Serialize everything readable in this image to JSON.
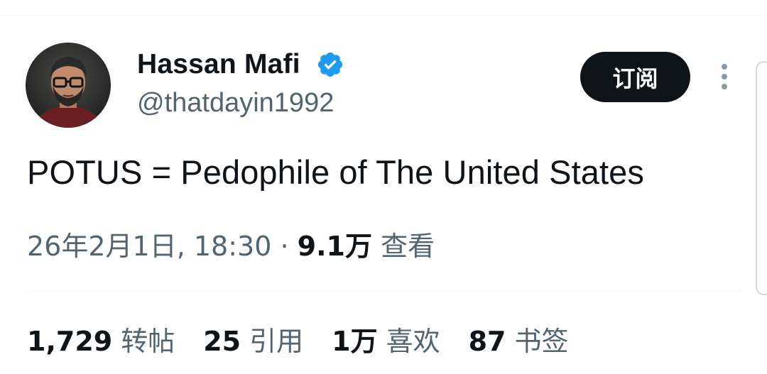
{
  "author": {
    "display_name": "Hassan Mafi",
    "handle": "@thatdayin1992",
    "verified_color": "#1d9bf0"
  },
  "actions": {
    "subscribe_label": "订阅",
    "more_icon": "more-vertical-icon"
  },
  "tweet": {
    "text": "POTUS = Pedophile of The United States"
  },
  "meta": {
    "timestamp": "26年2月1日, 18:30",
    "separator": " · ",
    "views_count": "9.1万",
    "views_label": "查看"
  },
  "stats": [
    {
      "count": "1,729",
      "label": "转帖"
    },
    {
      "count": "25",
      "label": "引用"
    },
    {
      "count": "1万",
      "label": "喜欢"
    },
    {
      "count": "87",
      "label": "书签"
    }
  ],
  "colors": {
    "text_primary": "#0f1419",
    "text_secondary": "#536471",
    "button_bg": "#0f1419",
    "divider": "#eff3f4"
  }
}
